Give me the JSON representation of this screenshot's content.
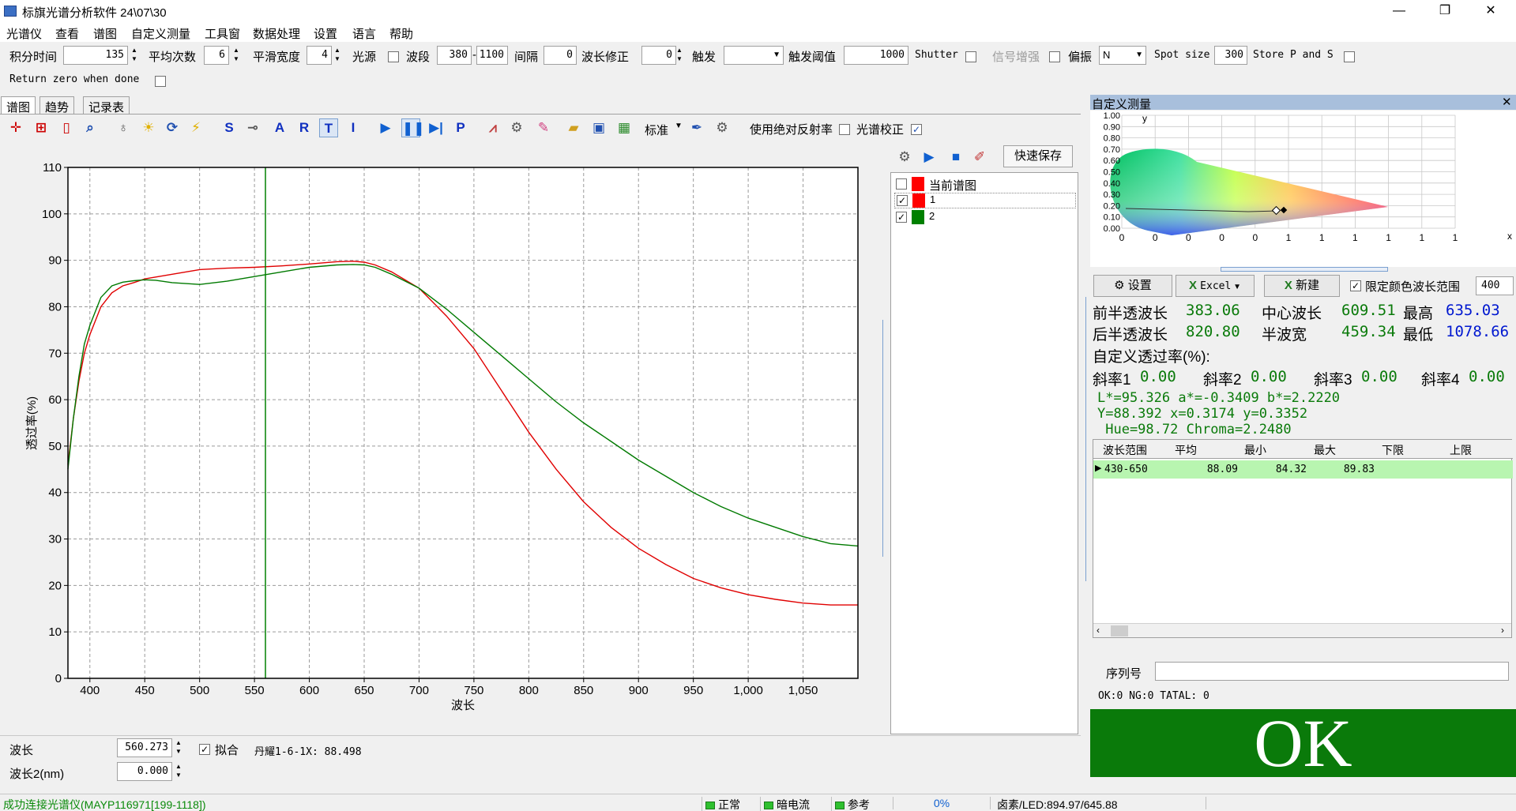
{
  "window": {
    "title": "标旗光谱分析软件 24\\07\\30",
    "minimize": "—",
    "restore": "❐",
    "close": "✕"
  },
  "menu": [
    "光谱仪",
    "查看",
    "谱图",
    "自定义测量",
    "工具窗",
    "数据处理",
    "设置",
    "语言",
    "帮助"
  ],
  "toolbar": {
    "integration_label": "积分时间",
    "integration_value": "135",
    "avg_label": "平均次数",
    "avg_value": "6",
    "smooth_label": "平滑宽度",
    "smooth_value": "4",
    "light_label": "光源",
    "band_label": "波段",
    "band_from": "380",
    "band_sep": "-",
    "band_to": "1100",
    "interval_label": "间隔",
    "interval_value": "0",
    "wl_corr_label": "波长修正",
    "wl_corr_value": "0",
    "trigger_label": "触发",
    "trigger_value": "",
    "trig_thresh_label": "触发阈值",
    "trig_thresh_value": "1000",
    "shutter_label": "Shutter",
    "signal_boost_label": "信号增强",
    "polar_label": "偏振",
    "polar_value": "N",
    "spot_label": "Spot size",
    "spot_value": "300",
    "store_label": "Store P and S",
    "return_zero_label": "Return zero when done"
  },
  "tabs": [
    "谱图",
    "趋势",
    "记录表"
  ],
  "icon_toolbar": {
    "letters": [
      "S",
      "A",
      "R",
      "T",
      "I",
      "P"
    ],
    "standard_label": "标准",
    "abs_reflect_label": "使用绝对反射率",
    "spec_calib_label": "光谱校正"
  },
  "legend": {
    "quick_save": "快速保存",
    "items": [
      {
        "label": "当前谱图",
        "checked": false,
        "color": "#ff0000"
      },
      {
        "label": "1",
        "checked": true,
        "color": "#ff0000"
      },
      {
        "label": "2",
        "checked": true,
        "color": "#008000"
      }
    ]
  },
  "chart_data": {
    "type": "line",
    "xlabel": "波长",
    "ylabel": "透过率(%)",
    "xlim": [
      380,
      1100
    ],
    "ylim": [
      0,
      110
    ],
    "xticks": [
      400,
      450,
      500,
      550,
      600,
      650,
      700,
      750,
      800,
      850,
      900,
      950,
      1000,
      1050
    ],
    "xtick_labels": [
      "400",
      "450",
      "500",
      "550",
      "600",
      "650",
      "700",
      "750",
      "800",
      "850",
      "900",
      "950",
      "1,000",
      "1,050"
    ],
    "yticks": [
      0,
      10,
      20,
      30,
      40,
      50,
      60,
      70,
      80,
      90,
      100,
      110
    ],
    "grid": true,
    "cursor_x": 560,
    "cursor_color": "#008000",
    "series": [
      {
        "color": "#e00000",
        "x": [
          380,
          385,
          390,
          395,
          400,
          410,
          420,
          430,
          440,
          450,
          475,
          500,
          525,
          550,
          575,
          600,
          625,
          640,
          650,
          660,
          675,
          700,
          725,
          750,
          775,
          800,
          825,
          850,
          875,
          900,
          925,
          950,
          975,
          1000,
          1025,
          1050,
          1075,
          1100
        ],
        "y": [
          46,
          56,
          64,
          70,
          74,
          80,
          83,
          84.5,
          85.2,
          86,
          87,
          88,
          88.3,
          88.5,
          88.8,
          89.2,
          89.7,
          89.8,
          89.6,
          89,
          87.5,
          84,
          78,
          71,
          62,
          53,
          45,
          38,
          32.5,
          28,
          24.5,
          21.5,
          19.5,
          18,
          17,
          16.2,
          15.8,
          15.8
        ]
      },
      {
        "color": "#007a00",
        "x": [
          380,
          385,
          390,
          395,
          400,
          410,
          420,
          430,
          440,
          450,
          460,
          475,
          500,
          525,
          550,
          575,
          600,
          625,
          640,
          650,
          660,
          675,
          700,
          725,
          750,
          775,
          800,
          825,
          850,
          875,
          900,
          925,
          950,
          975,
          1000,
          1025,
          1050,
          1075,
          1100
        ],
        "y": [
          45,
          56,
          65,
          72,
          76,
          82,
          84.5,
          85.3,
          85.6,
          85.8,
          85.7,
          85.2,
          84.8,
          85.5,
          86.5,
          87.5,
          88.5,
          89,
          89.1,
          89,
          88.5,
          87,
          84,
          79.5,
          74.5,
          69.5,
          64.5,
          59.5,
          55,
          51,
          47,
          43.5,
          40,
          37,
          34.5,
          32.5,
          30.5,
          29,
          28.5
        ]
      }
    ]
  },
  "bottom": {
    "wl_label": "波长",
    "wl_value": "560.273",
    "fit_label": "拟合",
    "readout": "丹耀1-6-1X: 88.498",
    "wl2_label": "波长2(nm)",
    "wl2_value": "0.000"
  },
  "cie": {
    "title": "自定义测量",
    "ylabel": "y",
    "xlabel": "x",
    "yticks": [
      "1.00",
      "0.90",
      "0.80",
      "0.70",
      "0.60",
      "0.50",
      "0.40",
      "0.30",
      "0.20",
      "0.10",
      "0.00"
    ],
    "xticks": [
      "0",
      "0",
      "0",
      "0",
      "0",
      "1",
      "1",
      "1",
      "1",
      "1",
      "1"
    ],
    "point_x": 0.3174,
    "point_y": 0.3352
  },
  "results": {
    "settings_btn": "设置",
    "excel_btn": "Excel",
    "new_btn": "新建",
    "limit_label": "限定颜色波长范围",
    "limit_value": "400",
    "front_half_label": "前半透波长",
    "front_half_value": "383.06",
    "center_label": "中心波长",
    "center_value": "609.51",
    "max_label": "最高",
    "max_value": "635.03",
    "back_half_label": "后半透波长",
    "back_half_value": "820.80",
    "half_width_label": "半波宽",
    "half_width_value": "459.34",
    "min_label": "最低",
    "min_value": "1078.66",
    "custom_trans_label": "自定义透过率(%):",
    "slopes": [
      {
        "label": "斜率1",
        "value": "0.00"
      },
      {
        "label": "斜率2",
        "value": "0.00"
      },
      {
        "label": "斜率3",
        "value": "0.00"
      },
      {
        "label": "斜率4",
        "value": "0.00"
      }
    ],
    "color_line1": "L*=95.326 a*=-0.3409 b*=2.2220",
    "color_line2": "Y=88.392 x=0.3174 y=0.3352",
    "color_line3": " Hue=98.72 Chroma=2.2480"
  },
  "table": {
    "headers": [
      "波长范围",
      "平均",
      "最小",
      "最大",
      "下限",
      "上限"
    ],
    "rows": [
      [
        "430-650",
        "88.09",
        "84.32",
        "89.83",
        "",
        ""
      ]
    ]
  },
  "serial": {
    "label": "序列号",
    "value": ""
  },
  "counts": "OK:0 NG:0 TATAL: 0",
  "verdict": {
    "text": "OK",
    "color": "#0a7a0a"
  },
  "status": {
    "connect": "成功连接光谱仪(MAYP116971[199-1118])",
    "normal": "正常",
    "dark": "暗电流",
    "ref": "参考",
    "progress": "0%",
    "lamp": "卤素/LED:894.97/645.88"
  }
}
